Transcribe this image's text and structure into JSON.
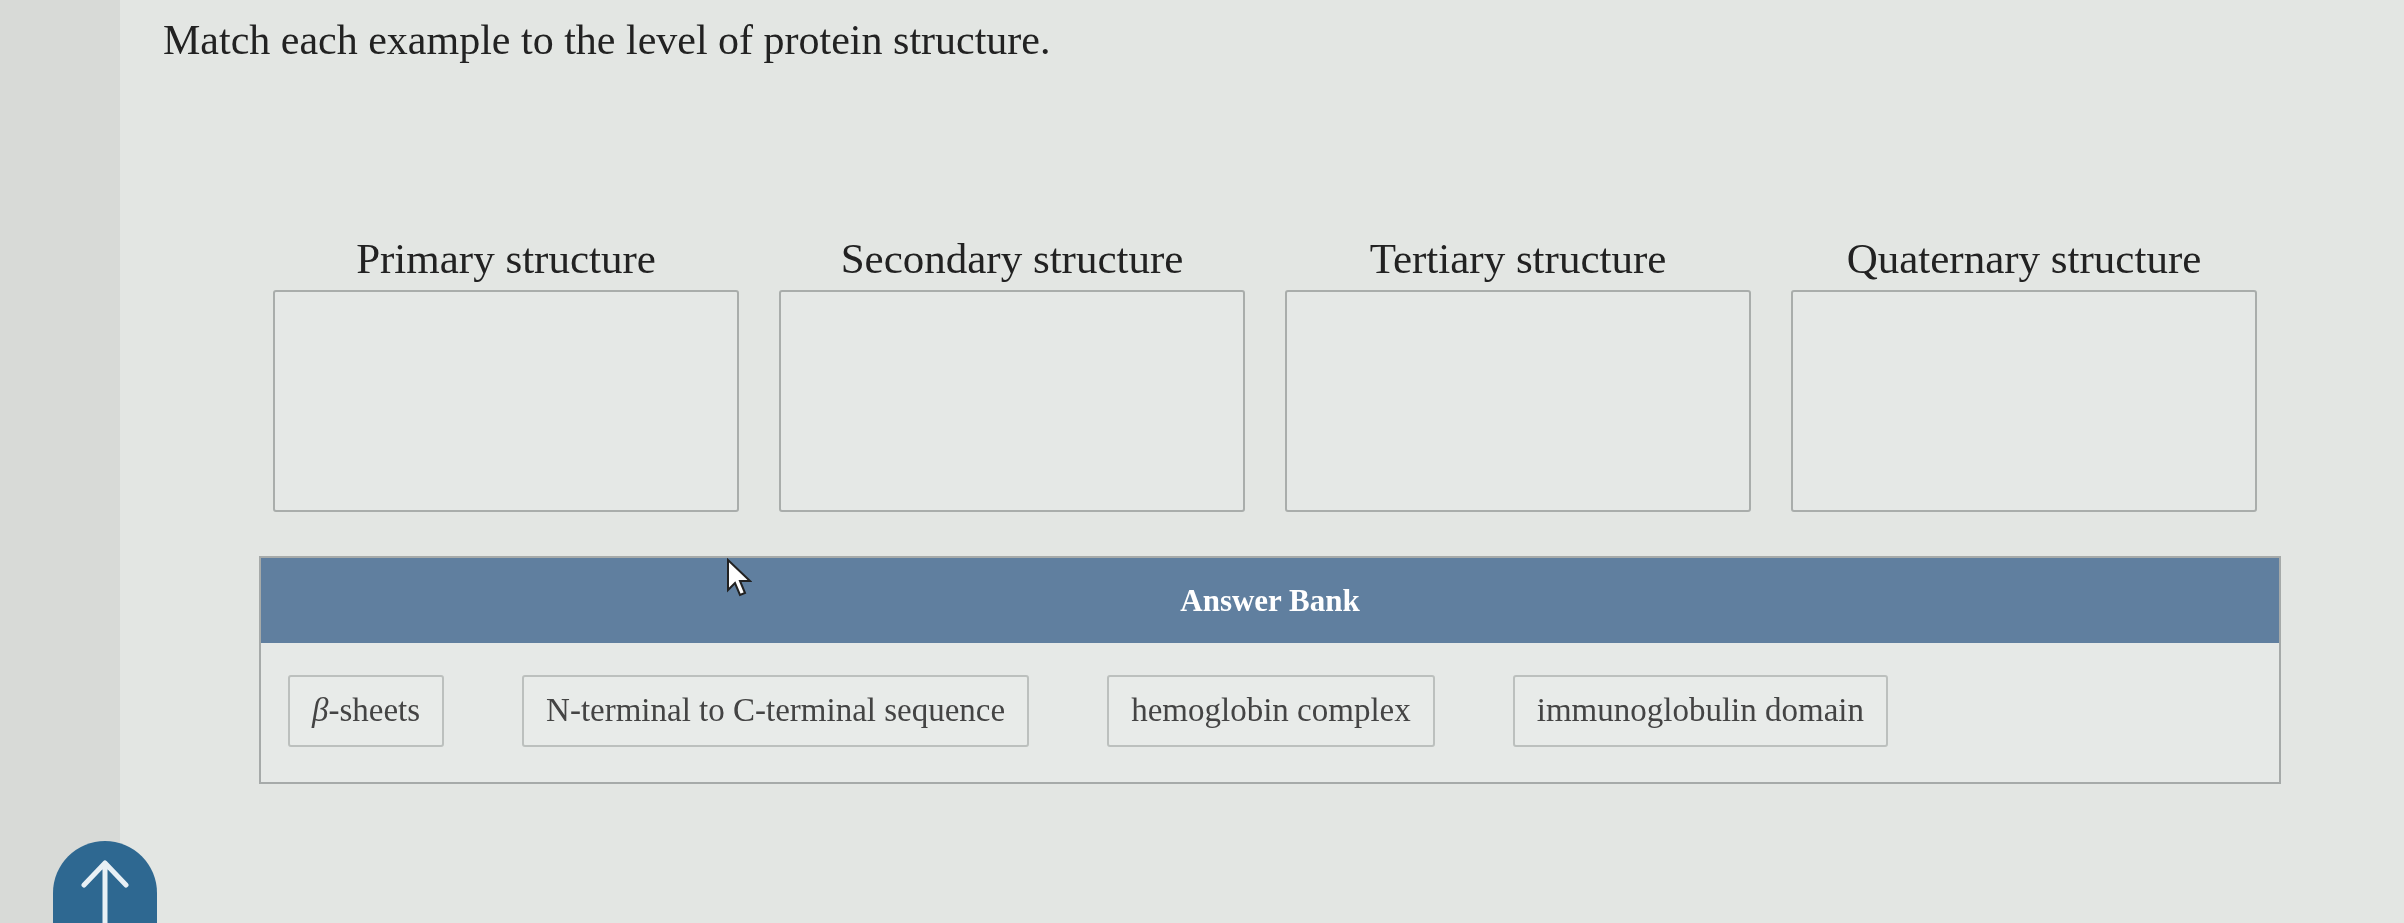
{
  "instruction": "Match each example to the level of protein structure.",
  "targets": [
    {
      "label": "Primary structure"
    },
    {
      "label": "Secondary structure"
    },
    {
      "label": "Tertiary structure"
    },
    {
      "label": "Quaternary structure"
    }
  ],
  "answer_bank": {
    "title": "Answer Bank",
    "items": [
      "*β*-sheets",
      "N-terminal to C-terminal sequence",
      "hemoglobin complex",
      "immunoglobulin domain"
    ]
  }
}
